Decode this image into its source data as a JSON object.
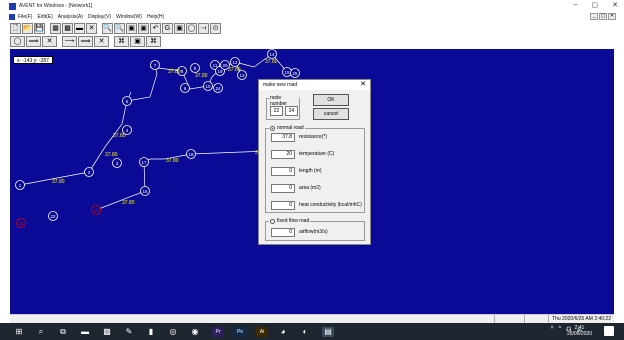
{
  "window": {
    "title": "AVENT for Windows - [Network1]",
    "controls": [
      "–",
      "▢",
      "✕"
    ]
  },
  "menu": {
    "items": [
      "File(F)",
      "Edit(E)",
      "Analysis(A)",
      "Display(V)",
      "Window(W)",
      "Help(H)"
    ],
    "mdi_controls": [
      "_",
      "▢",
      "✕"
    ]
  },
  "toolbar1": [
    "🗋",
    "📂",
    "💾",
    "▦",
    "▩",
    "▬",
    "✕",
    "🔍",
    "🔍",
    "▣",
    "▣",
    "↶",
    "G",
    "▣",
    "◯",
    "⟞",
    "⊙"
  ],
  "toolbar2": [
    "◯",
    "⟹",
    "✕",
    "⟶",
    "⟹",
    "✕",
    "⌘",
    "▣",
    "⌘"
  ],
  "canvas": {
    "coords": "x: -143 y: -287",
    "nodes": [
      "1",
      "2",
      "3",
      "4",
      "5",
      "6",
      "7",
      "8",
      "9",
      "10",
      "11",
      "12",
      "13",
      "14",
      "15",
      "16",
      "17",
      "18",
      "19",
      "20",
      "21",
      "22",
      "23",
      "24",
      "25"
    ],
    "edge_labels": [
      "37.80",
      "37.80",
      "37.80",
      "37.80",
      "37.80",
      "37.80",
      "37.80",
      "37.80",
      "37.80",
      "37.80"
    ]
  },
  "dialog": {
    "title": "make new road",
    "close": "✕",
    "node_number_label": "node number",
    "from_node": "22",
    "to_node": "24",
    "ok_label": "OK",
    "cancel_label": "cancel",
    "normal_road_label": "normal road",
    "resistance_value": "37.8",
    "resistance_label": "resistance(*)",
    "temperature_value": "20",
    "temperature_label": "temperature (C)",
    "length_value": "0",
    "length_label": "length (m)",
    "area_value": "0",
    "area_label": "area (m2)",
    "heat_value": "0",
    "heat_label": "heat conductivity (kcal/mhC)",
    "fixed_flow_label": "fixed flow road",
    "airflow_value": "0",
    "airflow_label": "airflow(m3/s)"
  },
  "statusbar": {
    "datetime": "Thu 2020/6/25  AM 2:40:22"
  },
  "taskbar": {
    "apps": [
      "⊞",
      "⌕",
      "⧉",
      "▬",
      "▩",
      "✎",
      "▮",
      "◎",
      "◉",
      "Pr",
      "Ps",
      "Ai",
      "◕",
      "◐",
      "▤"
    ],
    "tray": [
      "ᴬ",
      "^",
      "☊",
      "🔈"
    ],
    "time": "2:41",
    "date": "25/06/2020"
  },
  "colors": {
    "canvas_bg": "#0a0a96",
    "node_color": "#ffffff",
    "edge_label_color": "#ffff00",
    "highlight_red": "#d40000"
  }
}
